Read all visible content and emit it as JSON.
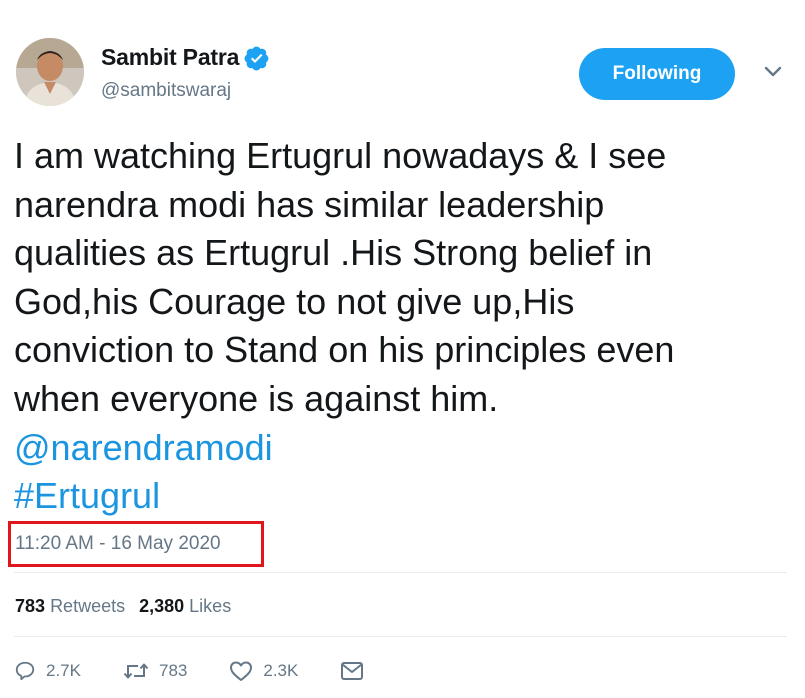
{
  "author": {
    "display_name": "Sambit Patra",
    "handle": "@sambitswaraj",
    "verified": true,
    "verified_color": "#1da1f2"
  },
  "follow_button": {
    "label": "Following",
    "color": "#1da1f2"
  },
  "tweet": {
    "lines": [
      "I am watching Ertugrul nowadays & I see",
      "narendra modi has similar leadership",
      "qualities as Ertugrul .His Strong belief in",
      "God,his Courage to not give up,His",
      "conviction to Stand on his principles even",
      "when everyone is against him."
    ],
    "mention": "@narendramodi",
    "hashtag": "#Ertugrul",
    "link_color": "#1b95e0"
  },
  "timestamp": "11:20 AM - 16 May 2020",
  "highlight_color": "#e0161e",
  "stats": {
    "retweets_count": "783",
    "retweets_label": "Retweets",
    "likes_count": "2,380",
    "likes_label": "Likes"
  },
  "actions": {
    "reply_count": "2.7K",
    "retweet_count": "783",
    "like_count": "2.3K",
    "icons": [
      "reply-icon",
      "retweet-icon",
      "like-icon",
      "message-icon"
    ]
  }
}
